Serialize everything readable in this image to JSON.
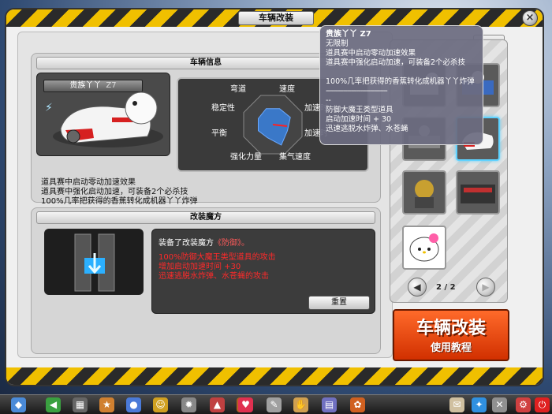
{
  "window": {
    "title": "车辆改装",
    "close_label": "×"
  },
  "vehicle_info": {
    "header": "车辆信息",
    "name": "贵族丫丫",
    "level": "Z7",
    "stats_labels": [
      "弯道",
      "速度",
      "加速时",
      "加速时",
      "集气速度",
      "强化力量",
      "平衡",
      "稳定性"
    ],
    "stat_levels": [
      0.55,
      0.6,
      0.5,
      0.7,
      0.45,
      0.5,
      0.5,
      0.55
    ],
    "desc_lines": [
      "道具赛中启动零动加速效果",
      "道具赛中强化启动加速，可装备2个必杀技",
      "100%几率把获得的香蕉转化成机器丫丫炸弹"
    ]
  },
  "mod_magic": {
    "header": "改装魔方",
    "equipped_prefix": "装备了改装魔方",
    "equipped_name": "《防御》。",
    "effect_lines": [
      "100%防御大魔王类型道具的攻击",
      "增加启动加速时间 +30",
      "迅速逃脱水炸弹、水苍蝇的攻击"
    ],
    "reset_label": "重置"
  },
  "pager": {
    "prev": "◀",
    "next": "▶",
    "text": "2 / 2"
  },
  "tutorial": {
    "line1": "车辆改装",
    "line2": "使用教程"
  },
  "tooltip": {
    "title": "贵族丫丫 Z7",
    "lines": [
      "无限制",
      "道具赛中启动零动加速效果",
      "道具赛中强化启动加速，可装备2个必杀技",
      "",
      "100%几率把获得的香蕉转化成机器丫丫炸弹",
      "--------------------------------",
      "--",
      "防御大魔王类型道具",
      "启动加速时间 + 30",
      "迅速逃脱水炸弹、水苍蝇"
    ]
  },
  "colors": {
    "hazard_yellow": "#f0c000",
    "effect_red": "#ff2a2a",
    "tutorial_orange": "#e54a10",
    "radar_blue": "#3a78c8"
  },
  "taskbar_icons": [
    "home-icon",
    "back-icon",
    "shop-icon",
    "rank-icon",
    "user-icon",
    "friend-icon",
    "gear-wheel-icon",
    "vehicle-icon",
    "chest-icon",
    "heart-icon",
    "sword-icon",
    "bag-icon",
    "book-icon",
    "pet-icon",
    "note-icon",
    "world-icon",
    "tools-icon",
    "settings-icon",
    "power-icon"
  ]
}
